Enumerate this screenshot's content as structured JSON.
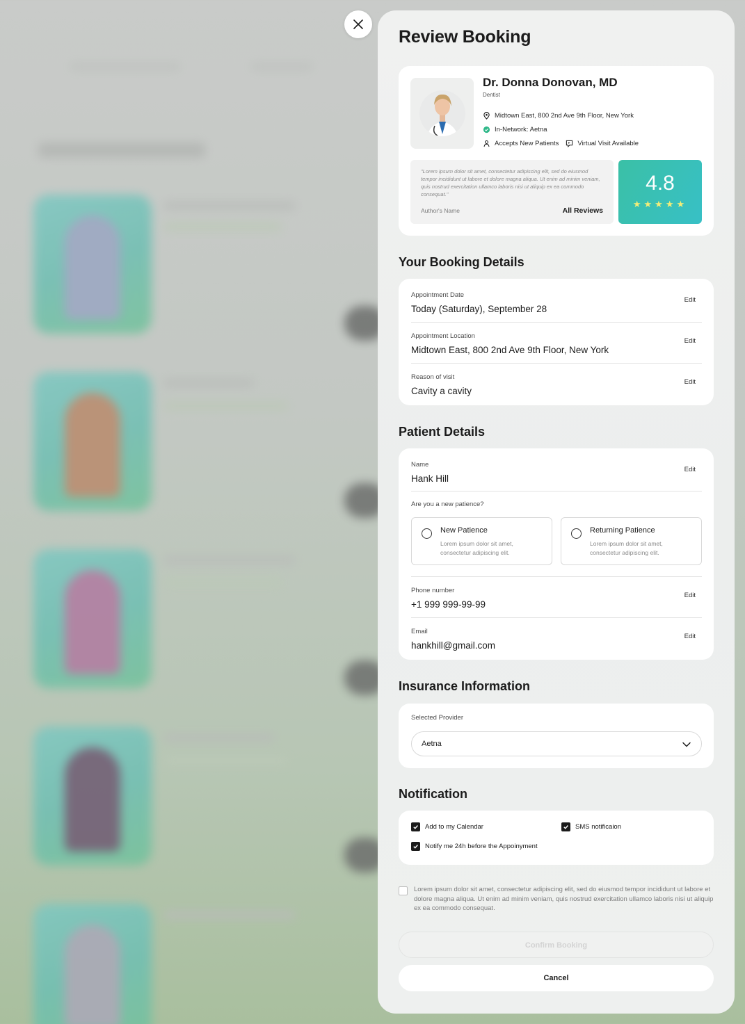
{
  "page": {
    "title": "Review Booking"
  },
  "doctor": {
    "name": "Dr. Donna Donovan, MD",
    "specialty": "Dentist",
    "address": "Midtown East, 800 2nd Ave 9th Floor, New York",
    "network": "In-Network: Aetna",
    "accepts": "Accepts New Patients",
    "virtual": "Virtual Visit Available",
    "review_text": "\"Lorem ipsum dolor sit amet, consectetur adipiscing elit, sed do eiusmod tempor incididunt ut labore et dolore magna aliqua. Ut enim ad minim veniam, quis nostrud exercitation ullamco laboris nisi ut aliquip ex ea commodo consequat.\"",
    "review_author": "Author's Name",
    "all_reviews_label": "All Reviews",
    "rating": "4.8",
    "stars": "★★★★★",
    "rating_stars_value": 5
  },
  "booking": {
    "heading": "Your Booking Details",
    "rows": [
      {
        "label": "Appointment Date",
        "value": "Today (Saturday), September 28",
        "edit": "Edit"
      },
      {
        "label": "Appointment Location",
        "value": "Midtown East, 800 2nd Ave 9th Floor, New York",
        "edit": "Edit"
      },
      {
        "label": "Reason of visit",
        "value": "Cavity a cavity",
        "edit": "Edit"
      }
    ]
  },
  "patient": {
    "heading": "Patient Details",
    "name": {
      "label": "Name",
      "value": "Hank Hill",
      "edit": "Edit"
    },
    "question": "Are you a new patience?",
    "options": [
      {
        "title": "New Patience",
        "desc": "Lorem ipsum dolor sit amet, consectetur adipiscing elit."
      },
      {
        "title": "Returning Patience",
        "desc": "Lorem ipsum dolor sit amet, consectetur adipiscing elit."
      }
    ],
    "phone": {
      "label": "Phone number",
      "value": "+1 999 999-99-99",
      "edit": "Edit"
    },
    "email": {
      "label": "Email",
      "value": "hankhill@gmail.com",
      "edit": "Edit"
    }
  },
  "insurance": {
    "heading": "Insurance Information",
    "label": "Selected Provider",
    "value": "Aetna"
  },
  "notification": {
    "heading": "Notification",
    "calendar": {
      "label": "Add to my Calendar",
      "checked": true
    },
    "sms": {
      "label": "SMS notificaion",
      "checked": true
    },
    "notify": {
      "label": "Notify me 24h before the Appoinyment",
      "checked": true
    }
  },
  "terms": {
    "text": "Lorem ipsum dolor sit amet, consectetur adipiscing elit, sed do eiusmod tempor incididunt ut labore et dolore magna aliqua. Ut enim ad minim veniam, quis nostrud exercitation ullamco laboris nisi ut aliquip ex ea commodo consequat.",
    "checked": false
  },
  "actions": {
    "confirm": "Confirm Booking",
    "cancel": "Cancel"
  },
  "colors": {
    "accent_gradient_start": "#3ac0a6",
    "accent_gradient_end": "#38c0c6",
    "star": "#f3ee78",
    "in_network": "#2fb889"
  },
  "icons": {
    "close": "close-icon",
    "location": "location-pin-icon",
    "network": "check-circle-icon",
    "accepts": "person-icon",
    "virtual": "video-chat-icon",
    "dropdown": "chevron-down-icon"
  }
}
